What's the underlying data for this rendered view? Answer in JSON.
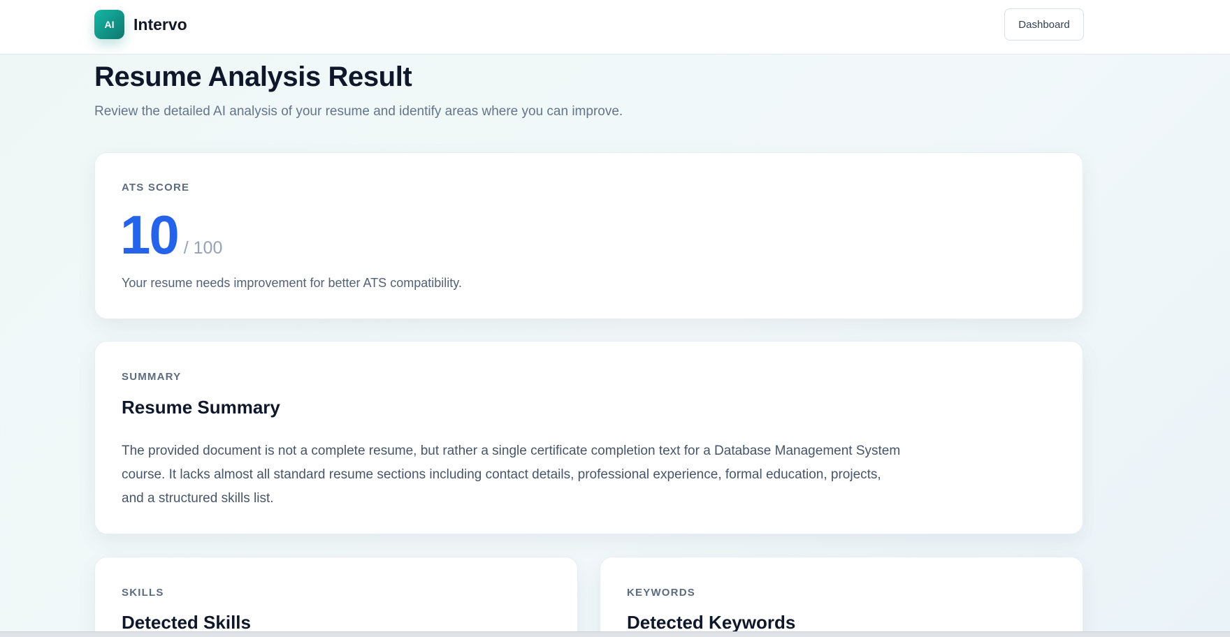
{
  "header": {
    "logo_badge": "AI",
    "brand_name": "Intervo",
    "dashboard_label": "Dashboard"
  },
  "page": {
    "title": "Resume Analysis Result",
    "subtitle": "Review the detailed AI analysis of your resume and identify areas where you can improve."
  },
  "ats": {
    "label": "ATS SCORE",
    "score": "10",
    "max": "/ 100",
    "note": "Your resume needs improvement for better ATS compatibility."
  },
  "summary": {
    "label": "SUMMARY",
    "heading": "Resume Summary",
    "text": "The provided document is not a complete resume, but rather a single certificate completion text for a Database Management System course. It lacks almost all standard resume sections including contact details, professional experience, formal education, projects, and a structured skills list."
  },
  "skills": {
    "label": "SKILLS",
    "heading": "Detected Skills"
  },
  "keywords": {
    "label": "KEYWORDS",
    "heading": "Detected Keywords"
  },
  "colors": {
    "accent": "#2563eb",
    "brand": "#14b8a6"
  }
}
